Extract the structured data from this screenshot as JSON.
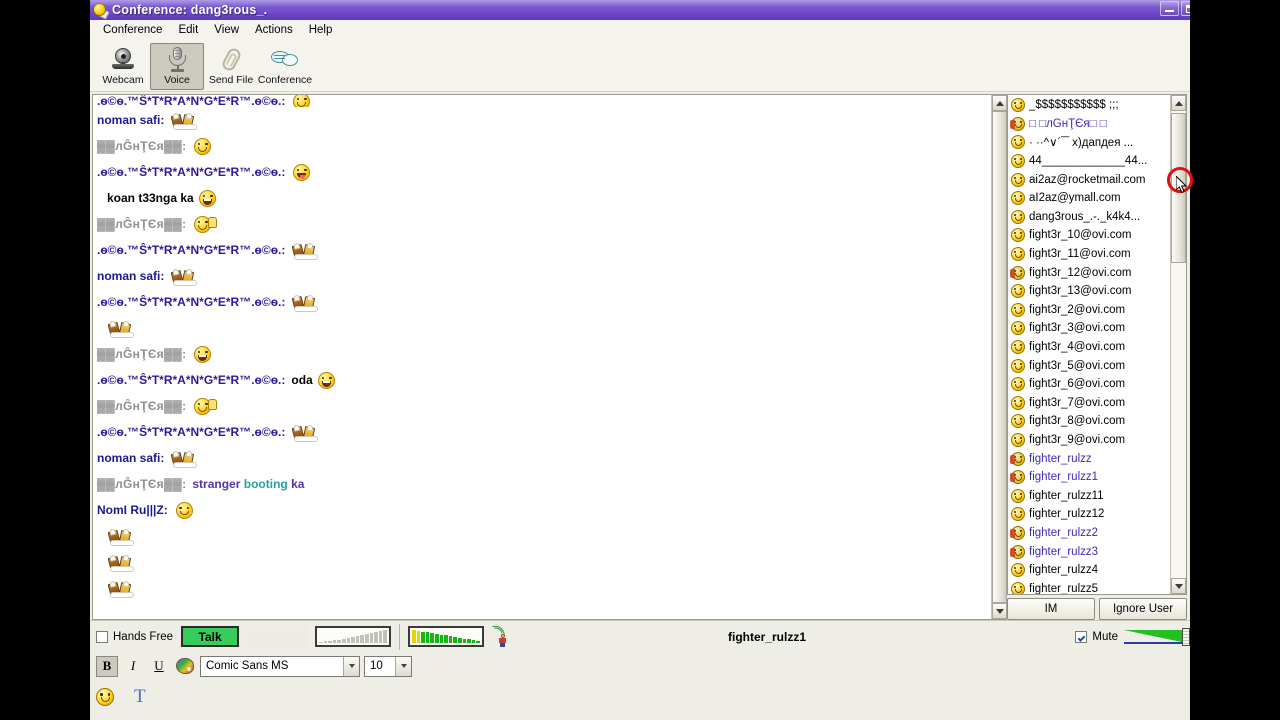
{
  "window": {
    "title": "Conference: dang3rous_.",
    "icon": "yahoo-messenger-icon",
    "minimize_label": "–",
    "maximize_label": "❐"
  },
  "menu": {
    "items": [
      {
        "label": "Conference"
      },
      {
        "label": "Edit"
      },
      {
        "label": "View"
      },
      {
        "label": "Actions"
      },
      {
        "label": "Help"
      }
    ]
  },
  "toolbar": {
    "buttons": [
      {
        "label": "Webcam",
        "icon": "webcam-icon",
        "pressed": false
      },
      {
        "label": "Voice",
        "icon": "microphone-icon",
        "pressed": true
      },
      {
        "label": "Send File",
        "icon": "paperclip-icon",
        "pressed": false
      },
      {
        "label": "Conference",
        "icon": "speech-bubbles-icon",
        "pressed": false
      }
    ]
  },
  "chat": {
    "lines": [
      {
        "nick": ".ѳ©ѳ.™Ŝ*T*R*A*N*G*E*R™.ѳ©ѳ.:",
        "nick_color": "purple",
        "clipped": true,
        "emoji": "smile",
        "text": ""
      },
      {
        "nick": "noman safi:",
        "nick_color": "blue",
        "emoji": "beer",
        "text": ""
      },
      {
        "nick": "▓▓лĜнŢЄя▓▓:",
        "nick_color": "grey",
        "emoji": "smile",
        "text": ""
      },
      {
        "nick": ".ѳ©ѳ.™Ŝ*T*R*A*N*G*E*R™.ѳ©ѳ.:",
        "nick_color": "purple",
        "emoji": "tongue",
        "text": ""
      },
      {
        "nick": "",
        "indent": true,
        "emoji": "grin",
        "text": "koan t33nga ka",
        "text_color": "dark"
      },
      {
        "nick": "▓▓лĜнŢЄя▓▓:",
        "nick_color": "grey",
        "emoji": "wave",
        "text": ""
      },
      {
        "nick": ".ѳ©ѳ.™Ŝ*T*R*A*N*G*E*R™.ѳ©ѳ.:",
        "nick_color": "purple",
        "emoji": "beer",
        "text": ""
      },
      {
        "nick": "noman safi:",
        "nick_color": "blue",
        "emoji": "beer",
        "text": ""
      },
      {
        "nick": ".ѳ©ѳ.™Ŝ*T*R*A*N*G*E*R™.ѳ©ѳ.:",
        "nick_color": "purple",
        "emoji": "beer",
        "text": ""
      },
      {
        "nick": "",
        "indent": true,
        "emoji": "beer",
        "text": ""
      },
      {
        "nick": "▓▓лĜнŢЄя▓▓:",
        "nick_color": "grey",
        "emoji": "grin",
        "text": ""
      },
      {
        "nick": ".ѳ©ѳ.™Ŝ*T*R*A*N*G*E*R™.ѳ©ѳ.:",
        "nick_color": "purple",
        "emoji": "grin",
        "text": "oda",
        "text_color": "dark"
      },
      {
        "nick": "▓▓лĜнŢЄя▓▓:",
        "nick_color": "grey",
        "emoji": "wave",
        "text": ""
      },
      {
        "nick": ".ѳ©ѳ.™Ŝ*T*R*A*N*G*E*R™.ѳ©ѳ.:",
        "nick_color": "purple",
        "emoji": "beer",
        "text": ""
      },
      {
        "nick": "noman safi:",
        "nick_color": "blue",
        "emoji": "beer",
        "text": ""
      },
      {
        "nick": "▓▓лĜнŢЄя▓▓:",
        "nick_color": "grey",
        "words": [
          {
            "t": "stranger",
            "c": "purple"
          },
          {
            "t": "booting",
            "c": "teal"
          },
          {
            "t": "ka",
            "c": "purple"
          }
        ]
      },
      {
        "nick": "NomI Ru|||Z:",
        "nick_color": "blue",
        "emoji": "blush",
        "text": ""
      },
      {
        "nick": "",
        "indent": true,
        "emoji": "beer",
        "text": ""
      },
      {
        "nick": "",
        "indent": true,
        "emoji": "beer",
        "text": ""
      },
      {
        "nick": "",
        "indent": true,
        "emoji": "beer",
        "text": ""
      }
    ]
  },
  "user_list": {
    "users": [
      {
        "name": "_$$$$$$$$$$$ ;;;",
        "status": "online",
        "highlight": false
      },
      {
        "name": "□ □лĜнŢЄя□ □",
        "status": "away",
        "highlight": true
      },
      {
        "name": "· ··^∨´‾‾ x)дапдея ...",
        "status": "online",
        "highlight": false
      },
      {
        "name": "44_____________44...",
        "status": "online",
        "highlight": false
      },
      {
        "name": "ai2az@rocketmail.com",
        "status": "online",
        "highlight": false
      },
      {
        "name": "aI2az@ymall.com",
        "status": "online",
        "highlight": false
      },
      {
        "name": "dang3rous_.-._k4k4...",
        "status": "online",
        "highlight": false
      },
      {
        "name": "fight3r_10@ovi.com",
        "status": "online",
        "highlight": false
      },
      {
        "name": "fight3r_11@ovi.com",
        "status": "online",
        "highlight": false
      },
      {
        "name": "fight3r_12@ovi.com",
        "status": "away",
        "highlight": false
      },
      {
        "name": "fight3r_13@ovi.com",
        "status": "online",
        "highlight": false
      },
      {
        "name": "fight3r_2@ovi.com",
        "status": "online",
        "highlight": false
      },
      {
        "name": "fight3r_3@ovi.com",
        "status": "online",
        "highlight": false
      },
      {
        "name": "fight3r_4@ovi.com",
        "status": "online",
        "highlight": false
      },
      {
        "name": "fight3r_5@ovi.com",
        "status": "online",
        "highlight": false
      },
      {
        "name": "fight3r_6@ovi.com",
        "status": "online",
        "highlight": false
      },
      {
        "name": "fight3r_7@ovi.com",
        "status": "online",
        "highlight": false
      },
      {
        "name": "fight3r_8@ovi.com",
        "status": "online",
        "highlight": false
      },
      {
        "name": "fight3r_9@ovi.com",
        "status": "online",
        "highlight": false
      },
      {
        "name": "fighter_rulzz",
        "status": "away",
        "highlight": true
      },
      {
        "name": "fighter_rulzz1",
        "status": "away",
        "highlight": true
      },
      {
        "name": "fighter_rulzz11",
        "status": "online",
        "highlight": false
      },
      {
        "name": "fighter_rulzz12",
        "status": "online",
        "highlight": false
      },
      {
        "name": "fighter_rulzz2",
        "status": "away",
        "highlight": true
      },
      {
        "name": "fighter_rulzz3",
        "status": "away",
        "highlight": true
      },
      {
        "name": "fighter_rulzz4",
        "status": "online",
        "highlight": false
      },
      {
        "name": "fighter_rulzz5",
        "status": "online",
        "highlight": false
      }
    ],
    "im_button": "IM",
    "ignore_button": "Ignore User"
  },
  "voice_bar": {
    "hands_free_label": "Hands Free",
    "hands_free_checked": false,
    "talk_label": "Talk",
    "talker_name": "fighter_rulzz1",
    "mute_label": "Mute",
    "mute_checked": true,
    "mic_meter_level": 0,
    "speaker_meter_level": 85
  },
  "format_bar": {
    "bold_label": "B",
    "italic_label": "I",
    "underline_label": "U",
    "color_icon": "palette-icon",
    "font_name": "Comic Sans MS",
    "font_size": "10",
    "bold_active": true
  },
  "input_bar": {
    "smiley_icon": "smiley-icon",
    "text_style_label": "T"
  },
  "colors": {
    "titlebar": "#6b47c6",
    "window_bg": "#eeeee6",
    "talk_green": "#38cc5a",
    "highlight_name": "#3b2bbd",
    "accent_red": "#e01010"
  }
}
